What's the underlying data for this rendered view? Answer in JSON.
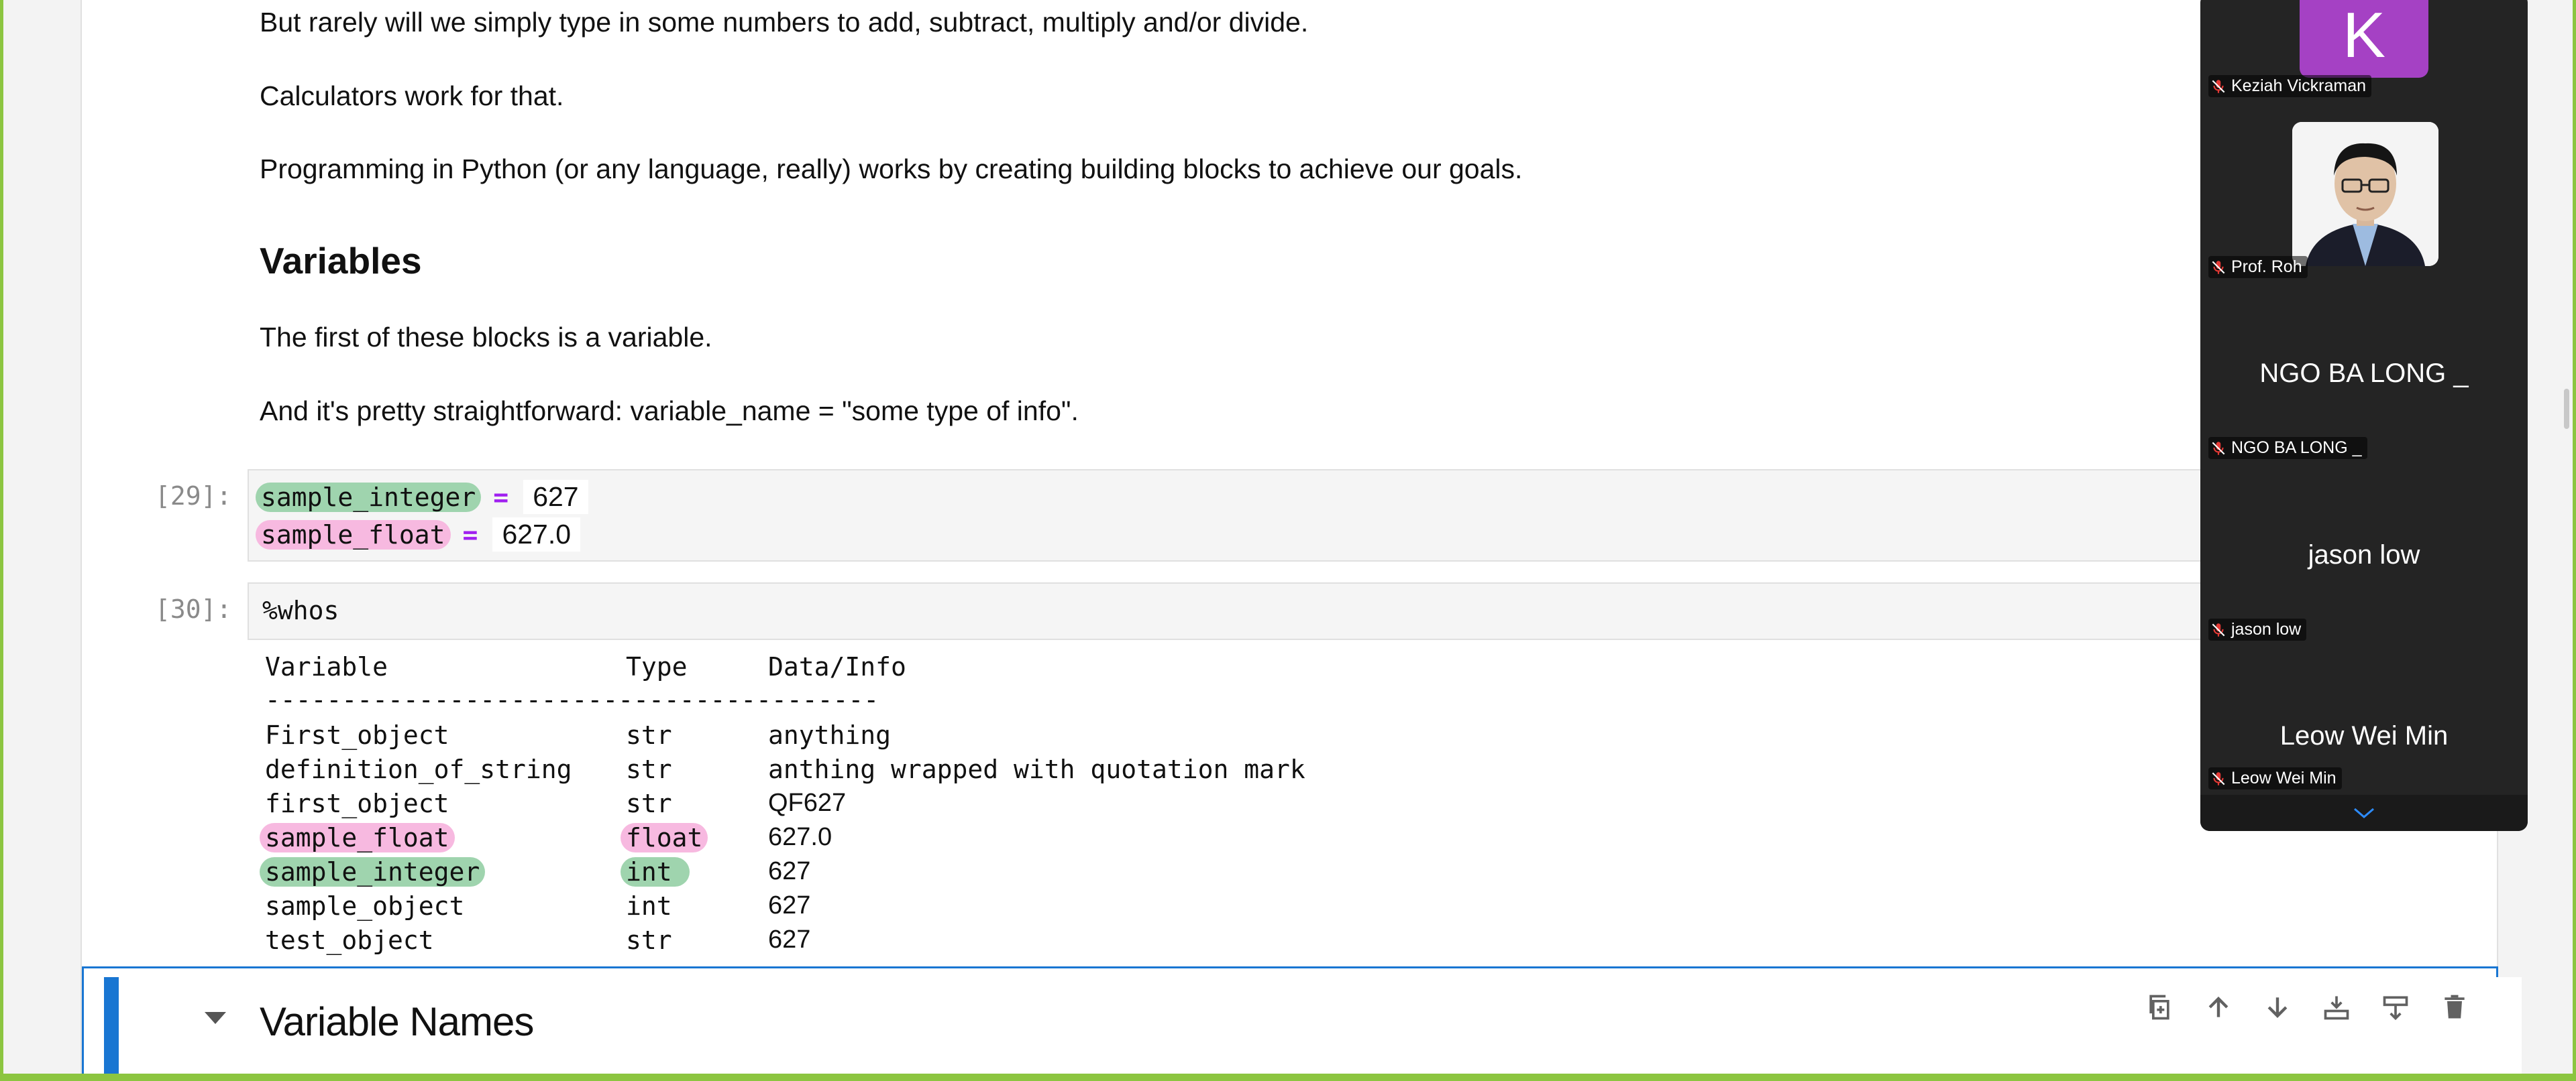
{
  "notebook": {
    "paragraphs": [
      "But rarely will we simply type in some numbers to add, subtract, multiply and/or divide.",
      "Calculators work for that.",
      "Programming in Python (or any language, really) works by creating building blocks to achieve our goals."
    ],
    "heading_variables": "Variables",
    "paragraph_first_block": "The first of these blocks is a variable.",
    "paragraph_straightforward": "And it's pretty straightforward: variable_name = \"some type of info\".",
    "cell29": {
      "prompt": "[29]:",
      "line1": {
        "name": "sample_integer",
        "op": "=",
        "value": "627"
      },
      "line2": {
        "name": "sample_float",
        "op": "=",
        "value": "627.0"
      }
    },
    "cell30": {
      "prompt": "[30]:",
      "code": "%whos",
      "output": {
        "headers": [
          "Variable",
          "Type",
          "Data/Info"
        ],
        "separator": "----------------------------------------",
        "rows": [
          [
            "First_object",
            "str",
            "anything"
          ],
          [
            "definition_of_string",
            "str",
            "anthing wrapped with quotation mark"
          ],
          [
            "first_object",
            "str",
            "QF627"
          ],
          [
            "sample_float",
            "float",
            "627.0"
          ],
          [
            "sample_integer",
            "int",
            "627"
          ],
          [
            "sample_object",
            "int",
            "627"
          ],
          [
            "test_object",
            "str",
            "627"
          ]
        ]
      }
    },
    "active_cell": {
      "heading": "Variable Names"
    },
    "highlight_colors": {
      "green": "#9fd4ae",
      "pink": "#f7b9e0"
    },
    "accent": "#1976d2"
  },
  "toolbar": {
    "icons": [
      "duplicate-icon",
      "move-up-icon",
      "move-down-icon",
      "insert-below-icon",
      "merge-icon",
      "delete-icon"
    ]
  },
  "video_panel": {
    "participants": [
      {
        "display": "K",
        "label": "Keziah Vickraman",
        "tile_color": "#a541c4"
      },
      {
        "display": "photo",
        "label": "Prof. Roh"
      },
      {
        "display": "NGO BA LONG _",
        "label": "NGO BA LONG _"
      },
      {
        "display": "jason low",
        "label": "jason low"
      },
      {
        "display": "Leow Wei Min",
        "label": "Leow Wei Min"
      }
    ]
  }
}
